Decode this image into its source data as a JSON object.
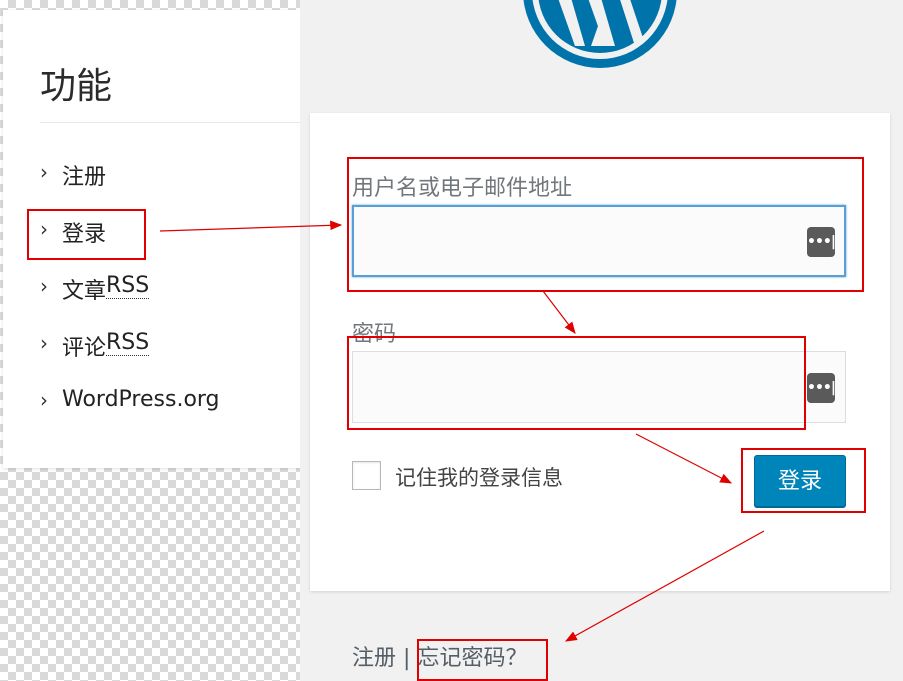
{
  "widget": {
    "title": "功能",
    "items": [
      {
        "label": "注册",
        "suffix": ""
      },
      {
        "label": "登录",
        "suffix": ""
      },
      {
        "label": "文章",
        "suffix": "RSS"
      },
      {
        "label": "评论",
        "suffix": "RSS"
      },
      {
        "label": "WordPress.org",
        "suffix": ""
      }
    ],
    "chevron": "›"
  },
  "login": {
    "username_label": "用户名或电子邮件地址",
    "username_value": "",
    "password_label": "密码",
    "password_value": "",
    "remember_label": "记住我的登录信息",
    "login_button": "登录",
    "register_link": "注册",
    "separator": "|",
    "lost_password_link": "忘记密码？",
    "password_manager_icon": "•••|"
  },
  "colors": {
    "accent": "#0085ba",
    "annotation": "#e00000",
    "wp_logo": "#0073aa"
  }
}
